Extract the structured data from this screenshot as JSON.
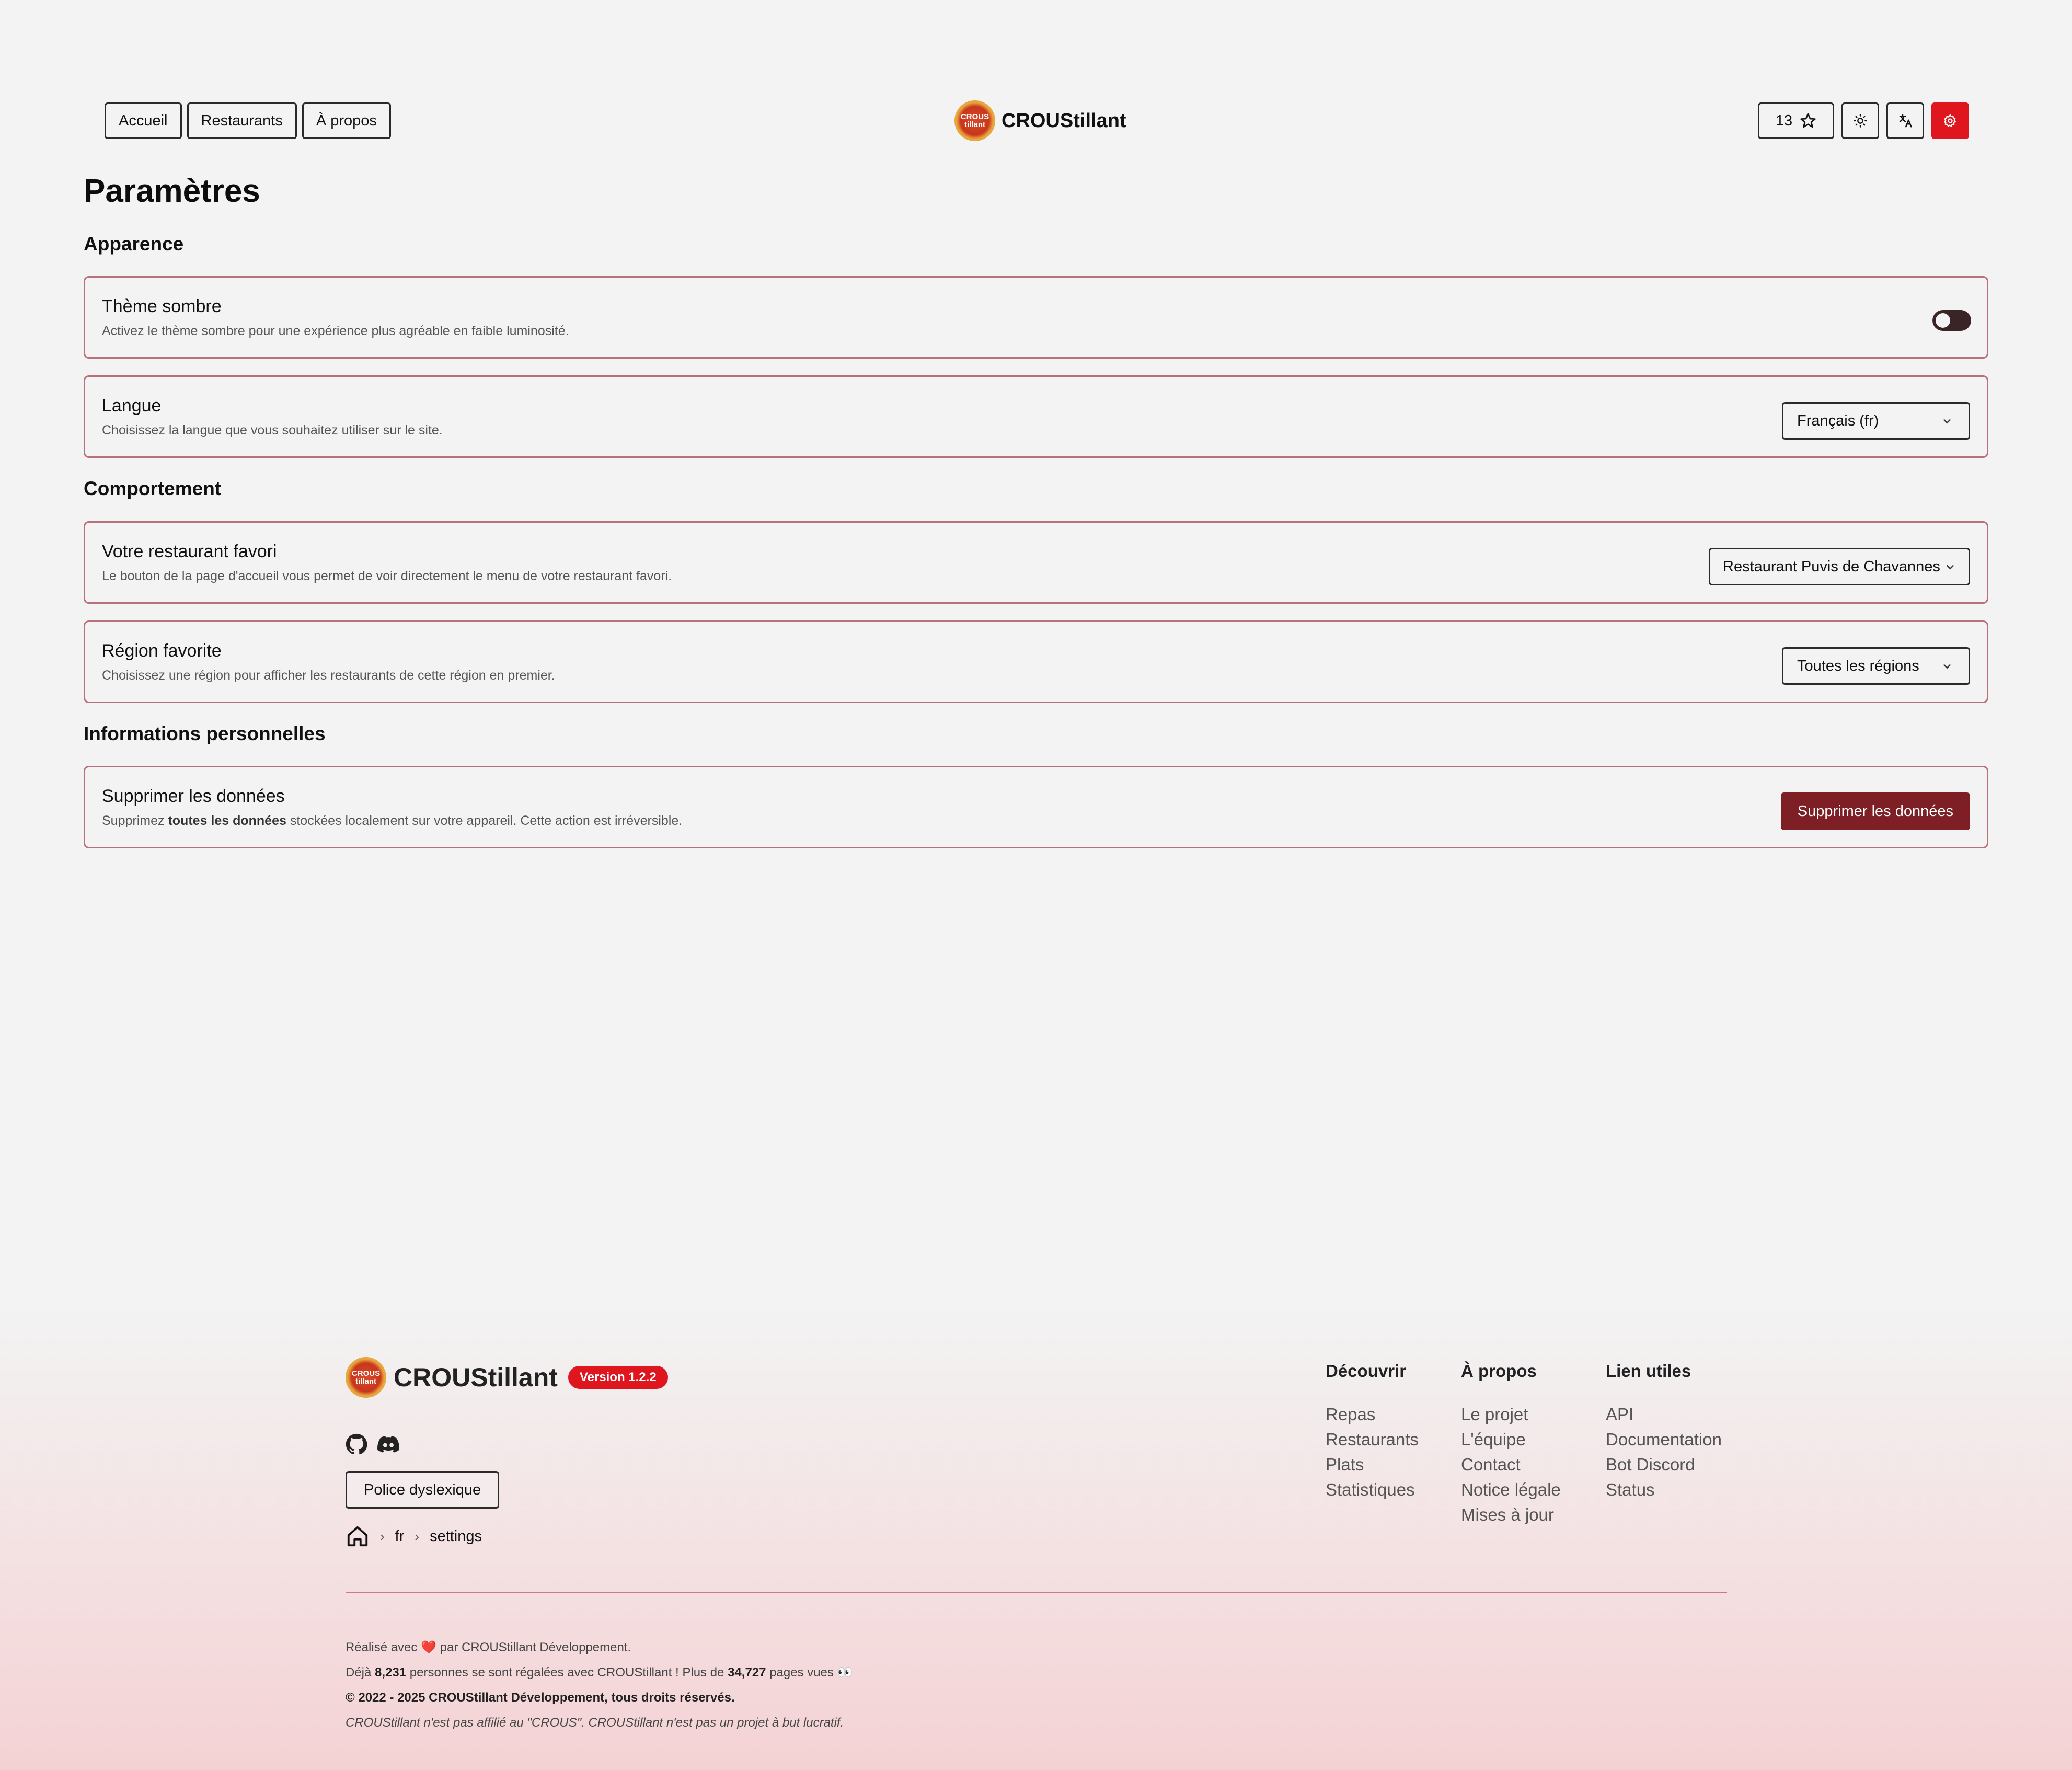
{
  "header": {
    "nav": [
      "Accueil",
      "Restaurants",
      "À propos"
    ],
    "brand": "CROUStillant",
    "logo_text_top": "CROUS",
    "logo_text_bottom": "tillant",
    "stars_count": "13",
    "icons": [
      "star-icon",
      "sun-icon",
      "translate-icon",
      "gear-icon"
    ],
    "accent": "#e0161f"
  },
  "page": {
    "title": "Paramètres",
    "sections": {
      "appearance": "Apparence",
      "behaviour": "Comportement",
      "personal": "Informations personnelles"
    },
    "dark_theme": {
      "title": "Thème sombre",
      "desc": "Activez le thème sombre pour une expérience plus agréable en faible luminosité.",
      "enabled": false
    },
    "language": {
      "title": "Langue",
      "desc": "Choisissez la langue que vous souhaitez utiliser sur le site.",
      "value": "Français (fr)"
    },
    "favorite_restaurant": {
      "title": "Votre restaurant favori",
      "desc": "Le bouton de la page d'accueil vous permet de voir directement le menu de votre restaurant favori.",
      "value": "Restaurant Puvis de Chavannes"
    },
    "favorite_region": {
      "title": "Région favorite",
      "desc": "Choisissez une région pour afficher les restaurants de cette région en premier.",
      "value": "Toutes les régions"
    },
    "delete_data": {
      "title": "Supprimer les données",
      "desc_prefix": "Supprimez ",
      "desc_bold": "toutes les données",
      "desc_suffix": " stockées localement sur votre appareil. Cette action est irréversible.",
      "button": "Supprimer les données",
      "button_color": "#7d1f25"
    }
  },
  "footer": {
    "brand": "CROUStillant",
    "version": "Version 1.2.2",
    "dyslexic_button": "Police dyslexique",
    "breadcrumb": [
      "fr",
      "settings"
    ],
    "columns": [
      {
        "title": "Découvrir",
        "links": [
          "Repas",
          "Restaurants",
          "Plats",
          "Statistiques"
        ]
      },
      {
        "title": "À propos",
        "links": [
          "Le projet",
          "L'équipe",
          "Contact",
          "Notice légale",
          "Mises à jour"
        ]
      },
      {
        "title": "Lien utiles",
        "links": [
          "API",
          "Documentation",
          "Bot Discord",
          "Status"
        ]
      }
    ],
    "made_with_prefix": "Réalisé avec ",
    "made_with_heart": "❤️",
    "made_with_suffix": " par CROUStillant Développement.",
    "stats_1": "Déjà ",
    "stats_people": "8,231",
    "stats_2": " personnes se sont régalées avec CROUStillant ! Plus de ",
    "stats_pages": "34,727",
    "stats_3": " pages vues 👀",
    "copyright": "© 2022 - 2025 CROUStillant Développement, tous droits réservés.",
    "disclaimer": "CROUStillant n'est pas affilié au \"CROUS\". CROUStillant n'est pas un projet à but lucratif."
  }
}
